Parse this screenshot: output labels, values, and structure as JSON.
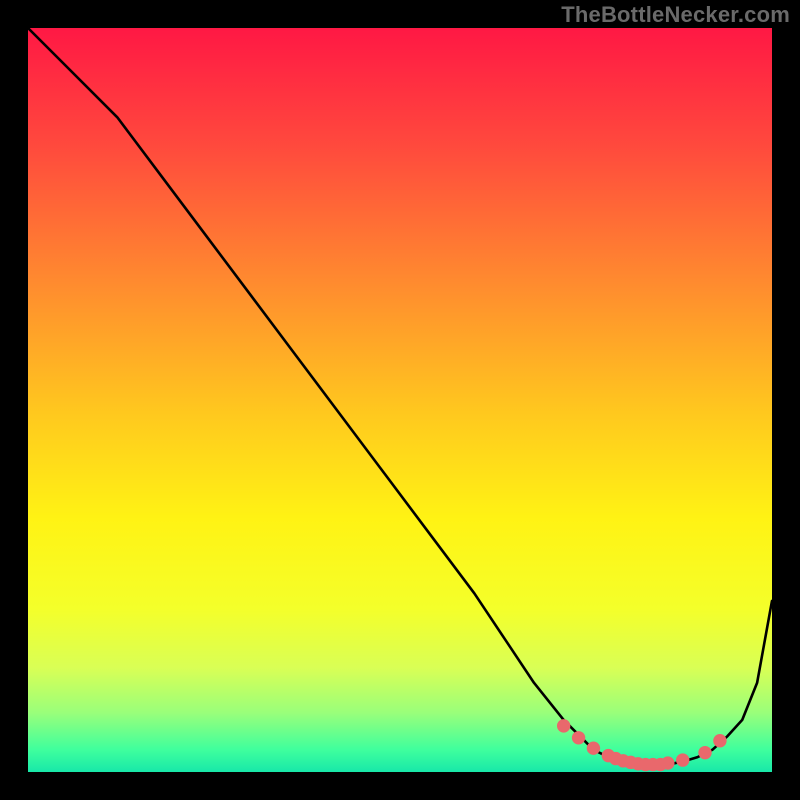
{
  "watermark": "TheBottleNecker.com",
  "colors": {
    "frame_bg": "#000000",
    "line": "#000000",
    "marker": "#e9686c",
    "gradient_stops": [
      {
        "offset": 0.0,
        "color": "#ff1844"
      },
      {
        "offset": 0.16,
        "color": "#ff4a3d"
      },
      {
        "offset": 0.34,
        "color": "#ff8a2f"
      },
      {
        "offset": 0.52,
        "color": "#ffc91e"
      },
      {
        "offset": 0.66,
        "color": "#fff314"
      },
      {
        "offset": 0.78,
        "color": "#f4ff2a"
      },
      {
        "offset": 0.86,
        "color": "#d9ff55"
      },
      {
        "offset": 0.92,
        "color": "#9aff7a"
      },
      {
        "offset": 0.97,
        "color": "#3fff9d"
      },
      {
        "offset": 1.0,
        "color": "#18e8a9"
      }
    ]
  },
  "chart_data": {
    "type": "line",
    "title": "",
    "xlabel": "",
    "ylabel": "",
    "xlim": [
      0,
      100
    ],
    "ylim": [
      0,
      100
    ],
    "legend": false,
    "grid": false,
    "series": [
      {
        "name": "curve",
        "x": [
          0,
          6,
          12,
          18,
          24,
          30,
          36,
          42,
          48,
          54,
          60,
          64,
          68,
          72,
          74,
          76,
          78,
          80,
          82,
          84,
          86,
          88,
          90,
          92,
          94,
          96,
          98,
          100
        ],
        "y": [
          100,
          94,
          88,
          80,
          72,
          64,
          56,
          48,
          40,
          32,
          24,
          18,
          12,
          7,
          5,
          3,
          2,
          1.5,
          1,
          1,
          1,
          1.4,
          2,
          3,
          4.8,
          7,
          12,
          23
        ]
      }
    ],
    "markers": {
      "name": "flat-zone-dots",
      "x": [
        72,
        74,
        76,
        78,
        79,
        80,
        81,
        82,
        83,
        84,
        85,
        86,
        88,
        91,
        93
      ],
      "y": [
        6.2,
        4.6,
        3.2,
        2.2,
        1.8,
        1.5,
        1.3,
        1.1,
        1.0,
        1.0,
        1.0,
        1.2,
        1.6,
        2.6,
        4.2
      ]
    }
  }
}
